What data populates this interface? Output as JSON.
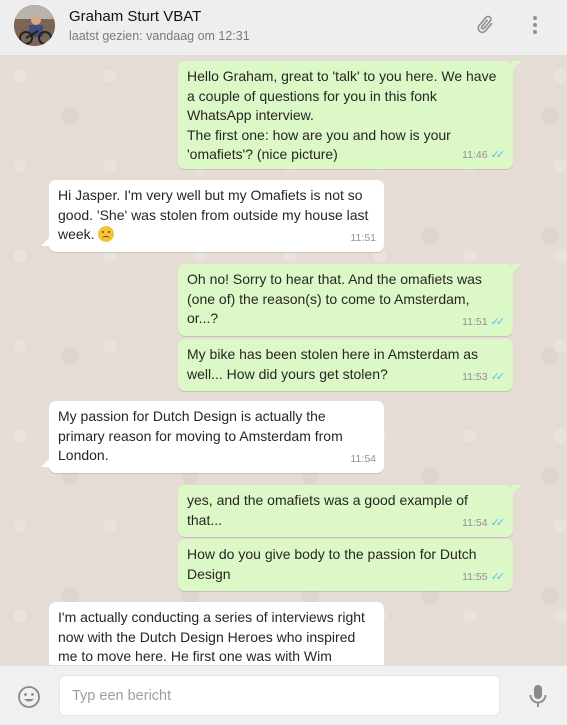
{
  "header": {
    "contact_name": "Graham Sturt VBAT",
    "last_seen": "laatst gezien: vandaag om 12:31",
    "avatar_icon": "profile-photo",
    "attach_icon": "paperclip-icon",
    "menu_icon": "kebab-menu-icon"
  },
  "messages": [
    {
      "dir": "out",
      "lines": [
        "Hello Graham, great to 'talk' to you here. We have",
        "a couple of questions for you in this fonk",
        "WhatsApp interview.",
        "The first one: how are you and how is your",
        "'omafiets'? (nice picture)"
      ],
      "time": "11:46",
      "read": true
    },
    {
      "dir": "in",
      "lines": [
        "Hi Jasper. I'm very well but my Omafiets is not so",
        "good. 'She' was stolen from outside my house last",
        "week."
      ],
      "emoji_after": "sad-face",
      "time": "11:51"
    },
    {
      "dir": "out",
      "lines": [
        "Oh no! Sorry to hear that. And the omafiets was",
        "(one of) the reason(s) to come to Amsterdam,",
        "or...?"
      ],
      "time": "11:51",
      "read": true
    },
    {
      "dir": "out",
      "lines": [
        "My bike has been stolen here in Amsterdam as",
        "well... How did yours get stolen?"
      ],
      "time": "11:53",
      "read": true
    },
    {
      "dir": "in",
      "lines": [
        "My passion for Dutch Design is actually the",
        "primary reason for moving to Amsterdam from",
        "London."
      ],
      "time": "11:54"
    },
    {
      "dir": "out",
      "lines": [
        "yes, and the omafiets was a good example of",
        "that..."
      ],
      "time": "11:54",
      "read": true
    },
    {
      "dir": "out",
      "lines": [
        "How do you give body to the passion for Dutch",
        "Design"
      ],
      "time": "11:55",
      "read": true
    },
    {
      "dir": "in",
      "lines": [
        "I'm actually conducting a series of interviews right",
        "now with the Dutch Design Heroes who inspired",
        "me to move here. He first one was with Wim"
      ],
      "time": ""
    }
  ],
  "footer": {
    "placeholder": "Typ een bericht",
    "emoji_icon": "smiley-icon",
    "mic_icon": "microphone-icon"
  },
  "colors": {
    "outgoing_bubble": "#dcf8c6",
    "incoming_bubble": "#ffffff",
    "read_ticks": "#4fc3f7",
    "chat_background": "#e5ddd5"
  }
}
